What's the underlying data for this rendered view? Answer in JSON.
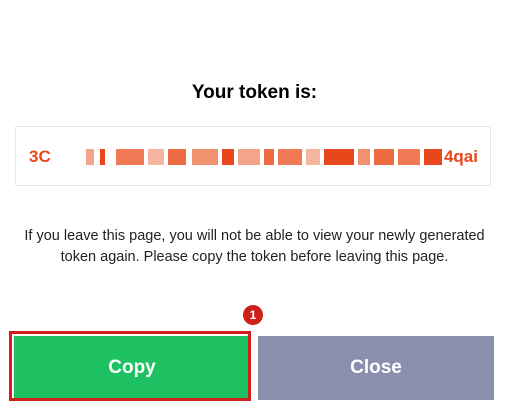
{
  "dialog": {
    "title": "Your token is:",
    "token_prefix": "3C",
    "token_suffix": "4qai",
    "token_redacted": true,
    "warning_text": "If you leave this page, you will not be able to view your newly generated token again. Please copy the token before leaving this page."
  },
  "buttons": {
    "copy_label": "Copy",
    "close_label": "Close"
  },
  "annotation": {
    "step_number": "1"
  },
  "colors": {
    "token_text": "#e8471b",
    "copy_button": "#1ec162",
    "close_button": "#8b8fae",
    "highlight": "#d0201b"
  }
}
